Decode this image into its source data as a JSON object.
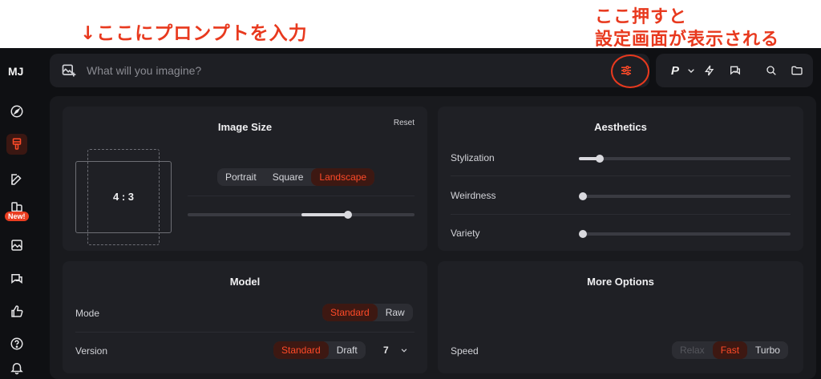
{
  "annotations": {
    "left": "↓ここにプロンプトを入力",
    "right_line1": "ここ押すと",
    "right_line2": "設定画面が表示される"
  },
  "sidebar": {
    "logo": "MJ",
    "new_badge": "New!",
    "icons": [
      "compass-icon",
      "brush-icon",
      "edit-icon",
      "pages-icon",
      "image-icon",
      "chat-icon",
      "thumbs-up-icon",
      "help-icon",
      "bell-icon"
    ]
  },
  "prompt": {
    "placeholder": "What will you imagine?"
  },
  "tools": {
    "personalize_label": "P"
  },
  "image_size": {
    "title": "Image Size",
    "reset": "Reset",
    "ratio": "4 : 3",
    "orientation_options": [
      "Portrait",
      "Square",
      "Landscape"
    ],
    "selected": "Landscape",
    "slider_value": 0.71
  },
  "aesthetics": {
    "title": "Aesthetics",
    "sliders": [
      {
        "label": "Stylization",
        "value": 0.1
      },
      {
        "label": "Weirdness",
        "value": 0.0
      },
      {
        "label": "Variety",
        "value": 0.0
      }
    ]
  },
  "model": {
    "title": "Model",
    "mode_label": "Mode",
    "mode_options": [
      "Standard",
      "Raw"
    ],
    "mode_selected": "Standard",
    "version_label": "Version",
    "version_options": [
      "Standard",
      "Draft"
    ],
    "version_selected": "Standard",
    "version_number": "7"
  },
  "more_options": {
    "title": "More Options",
    "speed_label": "Speed",
    "speed_options": [
      "Relax",
      "Fast",
      "Turbo"
    ],
    "speed_selected": "Fast"
  },
  "colors": {
    "accent": "#ea3d20",
    "background": "#0f1013",
    "card": "#1f2025"
  }
}
